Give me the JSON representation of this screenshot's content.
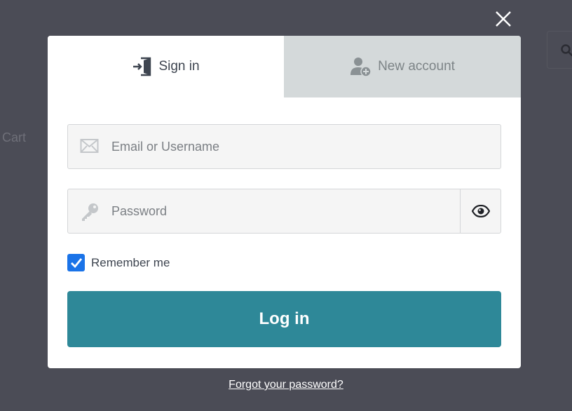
{
  "background": {
    "cart_label": "Cart"
  },
  "modal": {
    "tabs": [
      {
        "label": "Sign in",
        "icon": "sign-in-icon",
        "active": true
      },
      {
        "label": "New account",
        "icon": "add-user-icon",
        "active": false
      }
    ],
    "email_field": {
      "placeholder": "Email or Username",
      "value": ""
    },
    "password_field": {
      "placeholder": "Password",
      "value": ""
    },
    "remember_me": {
      "label": "Remember me",
      "checked": true
    },
    "login_button": "Log in",
    "forgot_password": "Forgot your password?"
  },
  "colors": {
    "overlay": "#4b4c56",
    "accent": "#2e8898",
    "checkbox": "#1a73e8",
    "inactive_tab": "#d4d9da"
  }
}
